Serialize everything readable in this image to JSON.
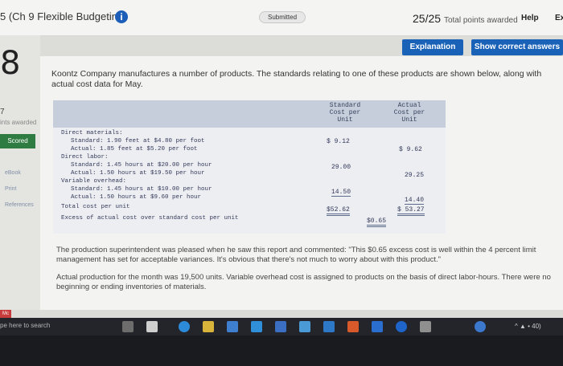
{
  "header": {
    "title": "5 (Ch 9 Flexible Budgeting)",
    "info_icon": "i",
    "status_badge": "Submitted",
    "score": "25/25",
    "score_caption": "Total points awarded",
    "help_label": "Help",
    "ex_label": "Ex"
  },
  "buttons": {
    "explanation": "Explanation",
    "show_correct": "Show correct answers"
  },
  "sidebar": {
    "question_number": "8",
    "points_digit": "7",
    "points_label": "ints awarded",
    "scored": "Scored",
    "links": [
      "eBook",
      "Print",
      "References"
    ]
  },
  "question": {
    "intro": "Koontz Company manufactures a number of products. The standards relating to one of these products are shown below, along with actual cost data for May.",
    "report": {
      "col_standard": [
        "Standard",
        "Cost per",
        "Unit"
      ],
      "col_actual": [
        "Actual",
        "Cost per",
        "Unit"
      ],
      "rows": [
        "Direct materials:",
        "Standard: 1.90 feet at $4.80 per foot",
        "Actual: 1.85 feet at $5.20 per foot",
        "Direct labor:",
        "Standard: 1.45 hours at $20.00 per hour",
        "Actual: 1.50 hours at $19.50 per hour",
        "Variable overhead:",
        "Standard: 1.45 hours at $10.00 per hour",
        "Actual: 1.50 hours at $9.60 per hour",
        "Total cost per unit",
        "Excess of actual cost over standard cost per unit"
      ],
      "values": {
        "std_materials": "$ 9.12",
        "act_materials": "$ 9.62",
        "std_labor": "29.00",
        "act_labor": "29.25",
        "std_overhead": "14.50",
        "act_overhead": "14.40",
        "std_total": "$52.62",
        "act_total": "$ 53.27",
        "excess": "$0.65"
      }
    },
    "para1": "The production superintendent was pleased when he saw this report and commented: \"This $0.65 excess cost is well within the 4 percent limit management has set for acceptable variances. It's obvious that there's not much to worry about with this product.\"",
    "para2": "Actual production for the month was 19,500 units. Variable overhead cost is assigned to products on the basis of direct labor-hours. There were no beginning or ending inventories of materials."
  },
  "taskbar": {
    "mc_tag": "Mc",
    "search_placeholder": "pe here to search",
    "tray_text": "^ ▲ • 40)"
  }
}
